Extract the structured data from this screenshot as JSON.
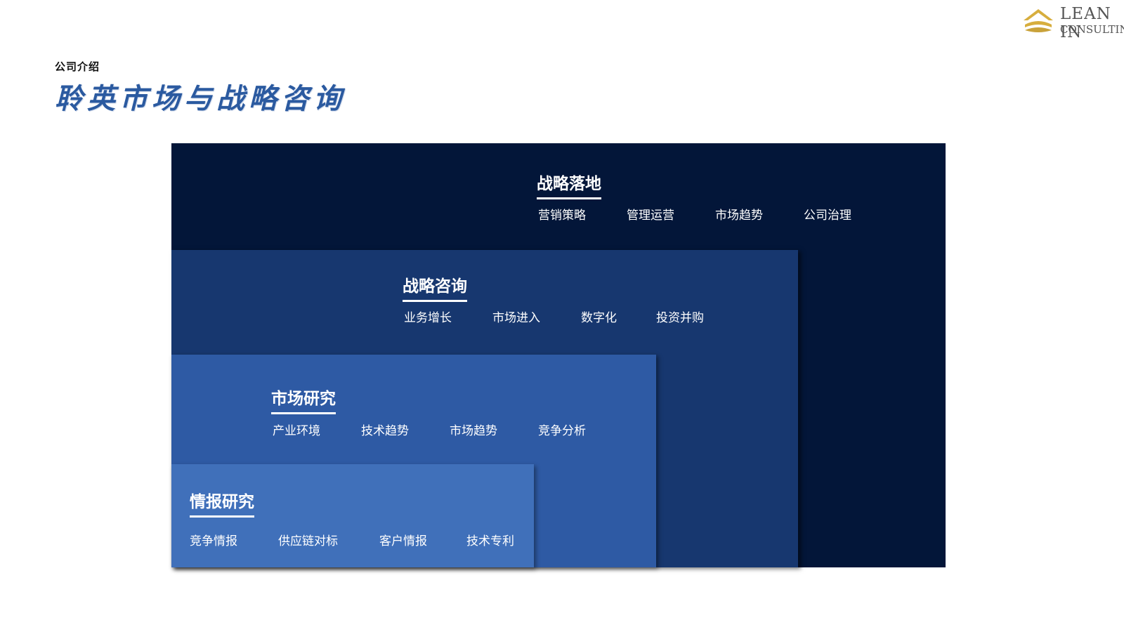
{
  "header": {
    "subtitle": "公司介绍",
    "title": "聆英市场与战略咨询"
  },
  "logo": {
    "line1": "LEAN IN",
    "line2": "CONSULTING",
    "accent_color": "#d7ae3e"
  },
  "layers": [
    {
      "heading": "战略落地",
      "items": [
        "营销策略",
        "管理运营",
        "市场趋势",
        "公司治理"
      ],
      "color": "#031639"
    },
    {
      "heading": "战略咨询",
      "items": [
        "业务增长",
        "市场进入",
        "数字化",
        "投资并购"
      ],
      "color": "#17376f"
    },
    {
      "heading": "市场研究",
      "items": [
        "产业环境",
        "技术趋势",
        "市场趋势",
        "竞争分析"
      ],
      "color": "#2e5aa4"
    },
    {
      "heading": "情报研究",
      "items": [
        "竞争情报",
        "供应链对标",
        "客户情报",
        "技术专利"
      ],
      "color": "#4070ba"
    }
  ]
}
